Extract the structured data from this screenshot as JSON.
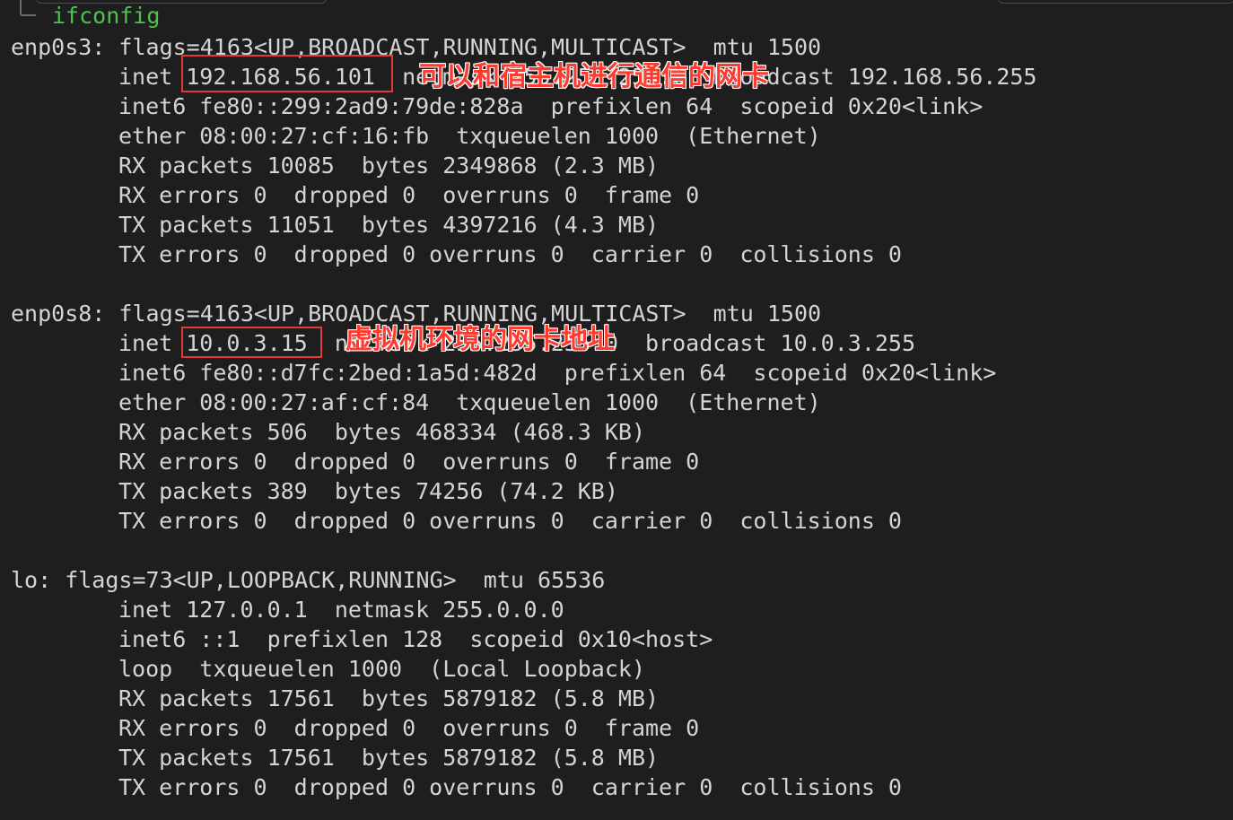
{
  "prompt": {
    "command": "ifconfig"
  },
  "lines": [
    "enp0s3: flags=4163<UP,BROADCAST,RUNNING,MULTICAST>  mtu 1500",
    "inet 192.168.56.101  netmask 255.255.255.0  broadcast 192.168.56.255",
    "inet6 fe80::299:2ad9:79de:828a  prefixlen 64  scopeid 0x20<link>",
    "ether 08:00:27:cf:16:fb  txqueuelen 1000  (Ethernet)",
    "RX packets 10085  bytes 2349868 (2.3 MB)",
    "RX errors 0  dropped 0  overruns 0  frame 0",
    "TX packets 11051  bytes 4397216 (4.3 MB)",
    "TX errors 0  dropped 0 overruns 0  carrier 0  collisions 0",
    "enp0s8: flags=4163<UP,BROADCAST,RUNNING,MULTICAST>  mtu 1500",
    "inet 10.0.3.15  netmask 255.255.255.0  broadcast 10.0.3.255",
    "inet6 fe80::d7fc:2bed:1a5d:482d  prefixlen 64  scopeid 0x20<link>",
    "ether 08:00:27:af:cf:84  txqueuelen 1000  (Ethernet)",
    "RX packets 506  bytes 468334 (468.3 KB)",
    "RX errors 0  dropped 0  overruns 0  frame 0",
    "TX packets 389  bytes 74256 (74.2 KB)",
    "TX errors 0  dropped 0 overruns 0  carrier 0  collisions 0",
    "lo: flags=73<UP,LOOPBACK,RUNNING>  mtu 65536",
    "inet 127.0.0.1  netmask 255.0.0.0",
    "inet6 ::1  prefixlen 128  scopeid 0x10<host>",
    "loop  txqueuelen 1000  (Local Loopback)",
    "RX packets 17561  bytes 5879182 (5.8 MB)",
    "RX errors 0  dropped 0  overruns 0  frame 0",
    "TX packets 17561  bytes 5879182 (5.8 MB)",
    "TX errors 0  dropped 0 overruns 0  carrier 0  collisions 0"
  ],
  "annotations": {
    "host_only": "可以和宿主机进行通信的网卡",
    "nat": "虚拟机环境的网卡地址"
  },
  "colors": {
    "background": "#1e1e1e",
    "text": "#d4d4d4",
    "command": "#4ec24e",
    "highlight": "#e23a3a",
    "annotation": "#ff3b30"
  }
}
